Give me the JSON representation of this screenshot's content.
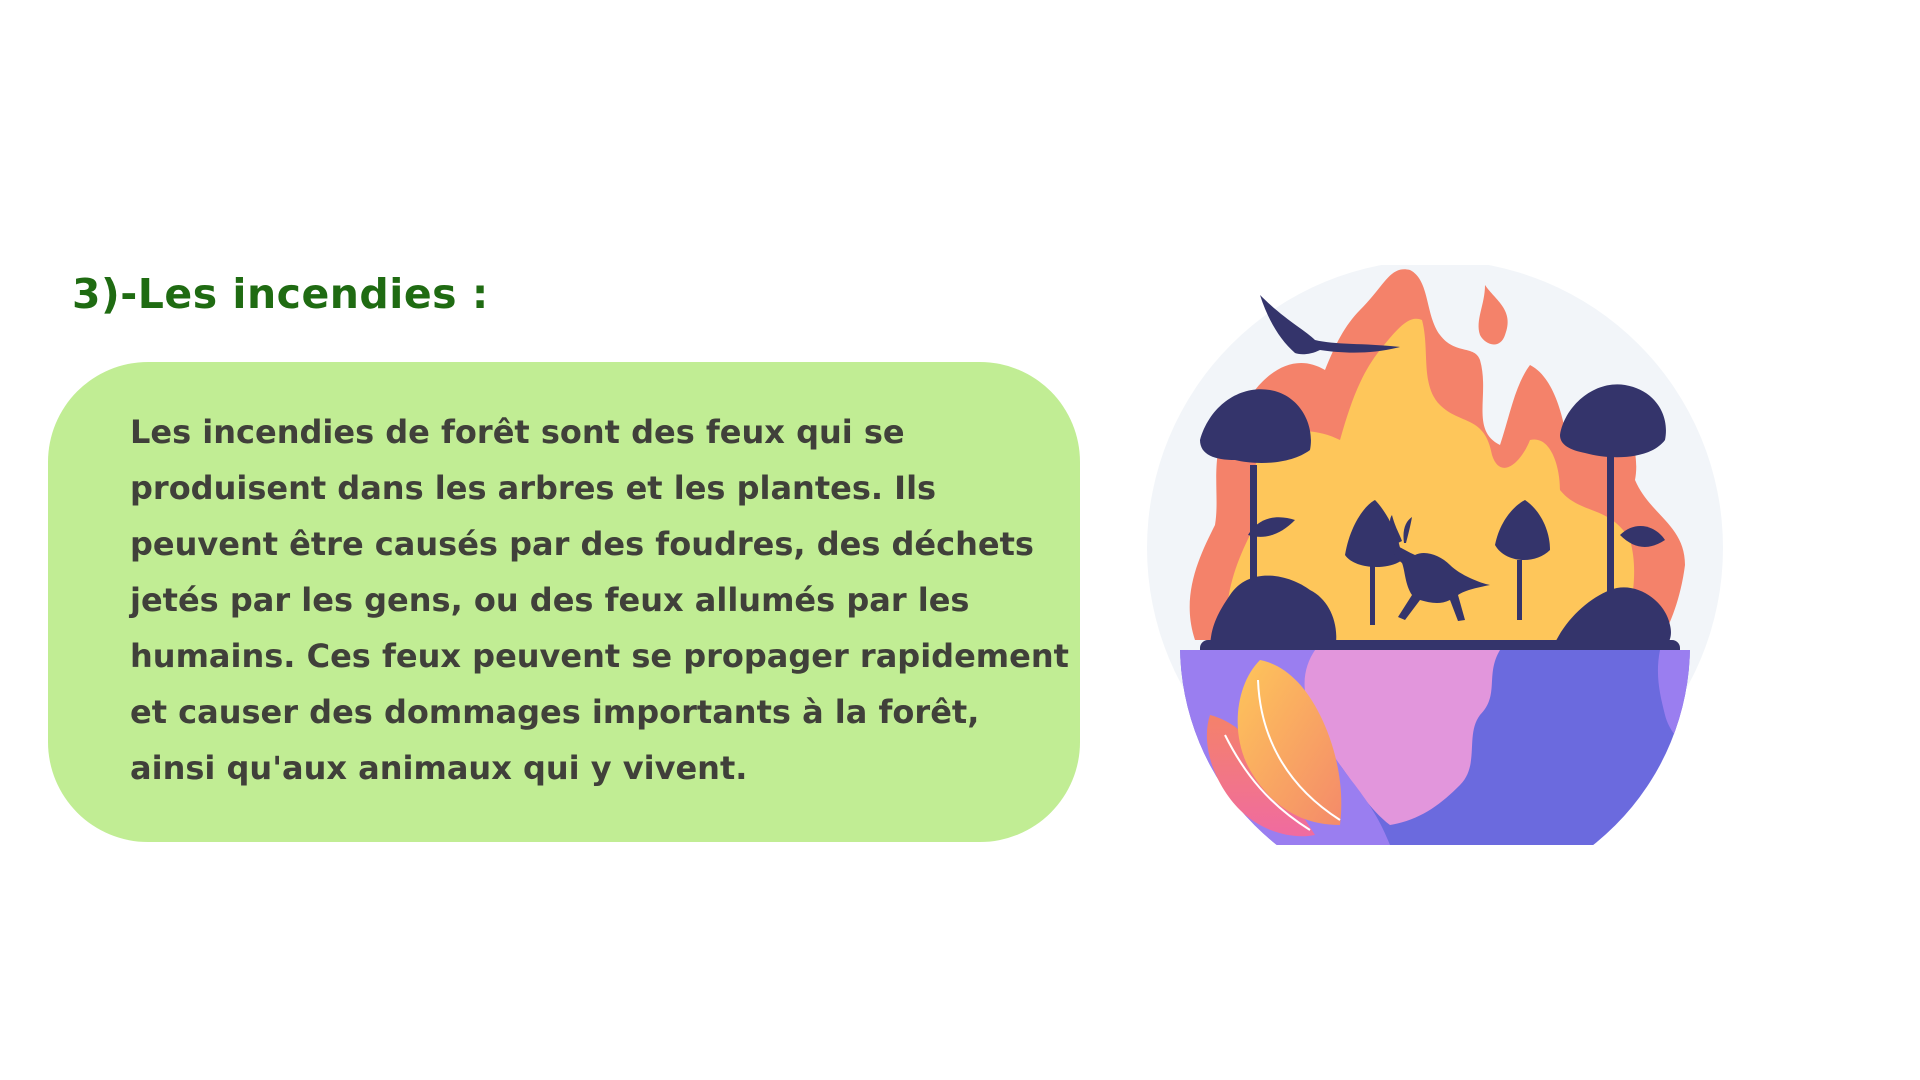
{
  "slide": {
    "title": "3)-Les incendies :",
    "body": "Les incendies de forêt sont des feux qui se produisent dans les arbres et les plantes. Ils peuvent être causés par des foudres, des déchets jetés par les gens, ou des feux allumés par les humains. Ces feux peuvent se propager rapidement et causer des dommages importants à la forêt, ainsi qu'aux animaux qui y vivent."
  },
  "illustration": {
    "icon": "burning-earth-icon"
  },
  "colors": {
    "title": "#1f6b12",
    "card": "#c1ed94",
    "text": "#40403a",
    "flame_outer": "#f4826a",
    "flame_inner": "#fec65a",
    "silhouette": "#34346b",
    "globe_purple": "#9a7ef0",
    "globe_pink": "#e296dc",
    "globe_blue": "#6b6ade"
  }
}
